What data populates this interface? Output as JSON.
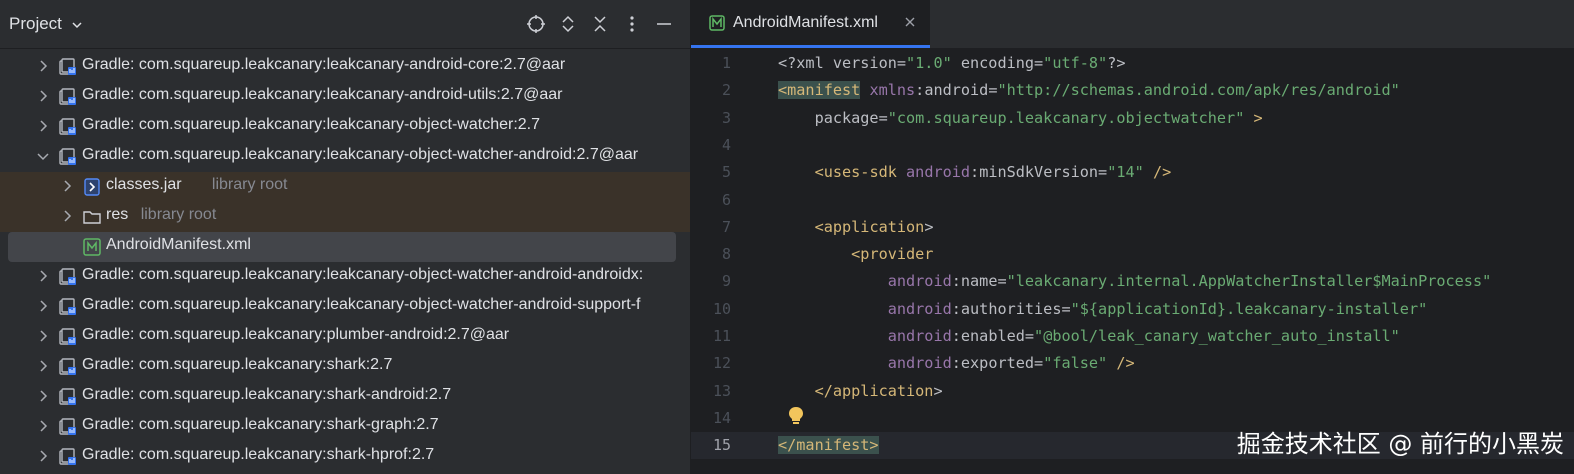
{
  "project_panel": {
    "title": "Project",
    "header_icons": [
      "crosshair-icon",
      "expand-all-icon",
      "collapse-all-icon",
      "more-vertical-icon",
      "minimize-icon"
    ],
    "tree": [
      {
        "label": "Gradle: com.squareup.leakcanary:leakcanary-android-core:2.7@aar",
        "sub": "",
        "icon": "library-icon",
        "expanded": false
      },
      {
        "label": "Gradle: com.squareup.leakcanary:leakcanary-android-utils:2.7@aar",
        "sub": "",
        "icon": "library-icon",
        "expanded": false
      },
      {
        "label": "Gradle: com.squareup.leakcanary:leakcanary-object-watcher:2.7",
        "sub": "",
        "icon": "library-icon",
        "expanded": false
      },
      {
        "label": "Gradle: com.squareup.leakcanary:leakcanary-object-watcher-android:2.7@aar",
        "sub": "",
        "icon": "library-icon",
        "expanded": true
      },
      {
        "label": "classes.jar",
        "sub": "library root",
        "icon": "jar-icon",
        "expanded": false
      },
      {
        "label": "res",
        "sub": "library root",
        "icon": "folder-icon",
        "expanded": false
      },
      {
        "label": "AndroidManifest.xml",
        "sub": "",
        "icon": "manifest-icon",
        "expanded": false
      },
      {
        "label": "Gradle: com.squareup.leakcanary:leakcanary-object-watcher-android-androidx:",
        "sub": "",
        "icon": "library-icon",
        "expanded": false
      },
      {
        "label": "Gradle: com.squareup.leakcanary:leakcanary-object-watcher-android-support-f",
        "sub": "",
        "icon": "library-icon",
        "expanded": false
      },
      {
        "label": "Gradle: com.squareup.leakcanary:plumber-android:2.7@aar",
        "sub": "",
        "icon": "library-icon",
        "expanded": false
      },
      {
        "label": "Gradle: com.squareup.leakcanary:shark:2.7",
        "sub": "",
        "icon": "library-icon",
        "expanded": false
      },
      {
        "label": "Gradle: com.squareup.leakcanary:shark-android:2.7",
        "sub": "",
        "icon": "library-icon",
        "expanded": false
      },
      {
        "label": "Gradle: com.squareup.leakcanary:shark-graph:2.7",
        "sub": "",
        "icon": "library-icon",
        "expanded": false
      },
      {
        "label": "Gradle: com.squareup.leakcanary:shark-hprof:2.7",
        "sub": "",
        "icon": "library-icon",
        "expanded": false
      }
    ]
  },
  "editor": {
    "tab": {
      "label": "AndroidManifest.xml",
      "icon": "manifest-icon",
      "close_icon": "close-icon"
    },
    "current_line": 15,
    "gutter_icon": "lightbulb-icon",
    "lines": [
      {
        "n": "1",
        "text": "<?xml version=\"1.0\" encoding=\"utf-8\"?>"
      },
      {
        "n": "2",
        "text": "<manifest xmlns:android=\"http://schemas.android.com/apk/res/android\""
      },
      {
        "n": "3",
        "text": "    package=\"com.squareup.leakcanary.objectwatcher\" >"
      },
      {
        "n": "4",
        "text": ""
      },
      {
        "n": "5",
        "text": "    <uses-sdk android:minSdkVersion=\"14\" />"
      },
      {
        "n": "6",
        "text": ""
      },
      {
        "n": "7",
        "text": "    <application>"
      },
      {
        "n": "8",
        "text": "        <provider"
      },
      {
        "n": "9",
        "text": "            android:name=\"leakcanary.internal.AppWatcherInstaller$MainProcess\""
      },
      {
        "n": "10",
        "text": "            android:authorities=\"${applicationId}.leakcanary-installer\""
      },
      {
        "n": "11",
        "text": "            android:enabled=\"@bool/leak_canary_watcher_auto_install\""
      },
      {
        "n": "12",
        "text": "            android:exported=\"false\" />"
      },
      {
        "n": "13",
        "text": "    </application>"
      },
      {
        "n": "14",
        "text": ""
      },
      {
        "n": "15",
        "text": "</manifest>"
      }
    ]
  },
  "watermark": "掘金技术社区 @ 前行的小黑炭",
  "colors": {
    "panel_bg": "#2b2d30",
    "editor_bg": "#1e1f22",
    "selection": "#43454a",
    "highlight": "#3a3229",
    "accent": "#3574f0",
    "xml_tag": "#d5b778",
    "xml_namespace": "#9876aa",
    "xml_string": "#6aab73"
  }
}
